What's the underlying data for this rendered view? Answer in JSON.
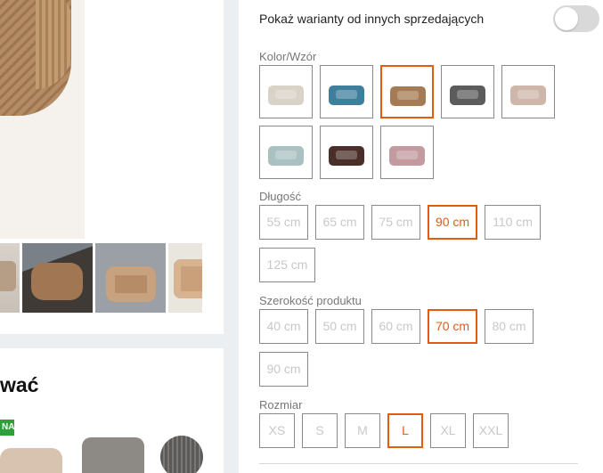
{
  "toggle": {
    "label": "Pokaż warianty od innych sprzedających",
    "on": false
  },
  "color": {
    "label": "Kolor/Wzór",
    "swatches": [
      {
        "name": "cream",
        "color": "#d9d2c6",
        "selected": false
      },
      {
        "name": "blue",
        "color": "#3e7f9b",
        "selected": false
      },
      {
        "name": "caramel",
        "color": "#a57b55",
        "selected": true
      },
      {
        "name": "graphite",
        "color": "#5c5c5c",
        "selected": false
      },
      {
        "name": "beige",
        "color": "#ceb7aa",
        "selected": false
      },
      {
        "name": "mint",
        "color": "#a9c2c1",
        "selected": false
      },
      {
        "name": "brown",
        "color": "#4a2f28",
        "selected": false
      },
      {
        "name": "pink",
        "color": "#c29a9f",
        "selected": false
      }
    ]
  },
  "length": {
    "label": "Długość",
    "options": [
      {
        "label": "55 cm",
        "selected": false
      },
      {
        "label": "65 cm",
        "selected": false
      },
      {
        "label": "75 cm",
        "selected": false
      },
      {
        "label": "90 cm",
        "selected": true
      },
      {
        "label": "110 cm",
        "selected": false
      },
      {
        "label": "125 cm",
        "selected": false
      }
    ]
  },
  "width": {
    "label": "Szerokość produktu",
    "options": [
      {
        "label": "40 cm",
        "selected": false
      },
      {
        "label": "50 cm",
        "selected": false
      },
      {
        "label": "60 cm",
        "selected": false
      },
      {
        "label": "70 cm",
        "selected": true
      },
      {
        "label": "80 cm",
        "selected": false
      },
      {
        "label": "90 cm",
        "selected": false
      }
    ]
  },
  "size": {
    "label": "Rozmiar",
    "options": [
      {
        "label": "XS",
        "selected": false
      },
      {
        "label": "S",
        "selected": false
      },
      {
        "label": "M",
        "selected": false
      },
      {
        "label": "L",
        "selected": true
      },
      {
        "label": "XL",
        "selected": false
      },
      {
        "label": "XXL",
        "selected": false
      }
    ]
  },
  "recommend": {
    "title_fragment": "wać",
    "badge": "NA"
  },
  "colors": {
    "accent": "#e25c0f",
    "toggle_off": "#d9d9d9",
    "badge": "#2e9f3a"
  }
}
